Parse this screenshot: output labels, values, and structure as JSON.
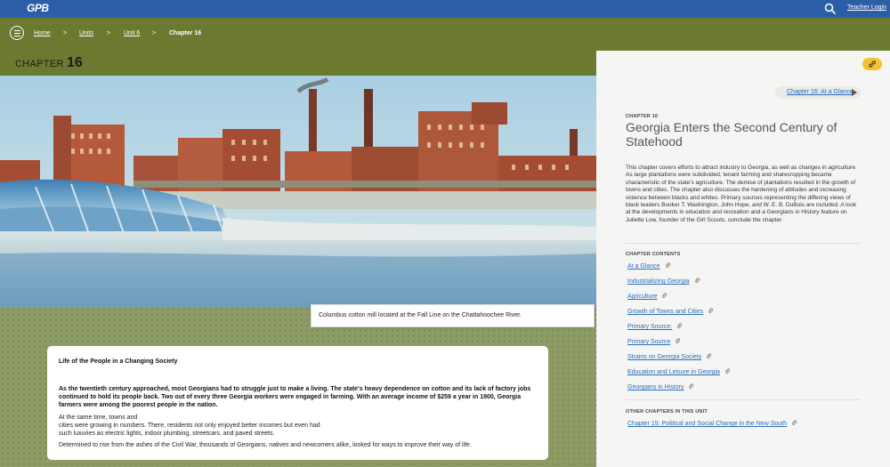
{
  "topbar": {
    "logo": "GPB",
    "teacher_login": "Teacher Login"
  },
  "breadcrumb": {
    "home": "Home",
    "units": "Units",
    "unit": "Unit 6",
    "current": "Chapter 16",
    "separator": ">"
  },
  "chapter": {
    "label": "CHAPTER",
    "number": "16"
  },
  "hero": {
    "caption": "Columbus cotton mill located at the Fall Line on the Chattahoochee River."
  },
  "card": {
    "title": "Life of the People in a Changing Society",
    "lead": "As the twentieth century approached, most Georgians had to struggle just to make a living. The state's heavy dependence on cotton and its lack of factory jobs continued to hold its people back. Two out of every three Georgia workers were engaged in farming. With an average income of $259 a year in 1900, Georgia farmers were among the poorest people in the nation.",
    "p1_line1": "At the same time, towns and",
    "p1_line2": "cities were growing in numbers. There, residents not only enjoyed better incomes but even had",
    "p1_line3": "such luxuries as electric lights, indoor plumbing, streetcars, and paved streets.",
    "p2": "Determined to rise from the ashes of the Civil War, thousands of Georgians, natives and newcomers alike, looked for ways to improve their way of life."
  },
  "sidebar": {
    "glance_link": "Chapter 16: At a Glance",
    "kicker": "CHAPTER 16",
    "title": "Georgia Enters the Second Century of Statehood",
    "description": "This chapter covers efforts to attract industry to Georgia, as well as changes in agriculture. As large plantations were subdivided, tenant farming and sharecropping became characteristic of the state's agriculture. The demise of plantations resulted in the growth of towns and cities. The chapter also discusses the hardening of attitudes and increasing violence between blacks and whites. Primary sources representing the differing views of black leaders Booker T. Washington, John Hope, and W. E. B. DuBois are included. A look at the developments in education and recreation and a Georgians in History feature on Juliette Low, founder of the Girl Scouts, conclude the chapter.",
    "contents_heading": "CHAPTER CONTENTS",
    "contents": [
      "At a Glance",
      "Industrializing Georgia",
      "Agriculture",
      "Growth of Towns and Cities",
      "Primary Source:",
      "Primary Source",
      "Strains on Georgia Society",
      "Education and Leisure in Georgia",
      "Georgians in History"
    ],
    "other_heading": "OTHER CHAPTERS IN THIS UNIT",
    "other": [
      "Chapter 15: Political and Social Change in the New South"
    ]
  },
  "colors": {
    "topbar": "#2c5ea8",
    "olive": "#6b7a30",
    "link": "#2a6ebb",
    "accent": "#f4c430"
  }
}
